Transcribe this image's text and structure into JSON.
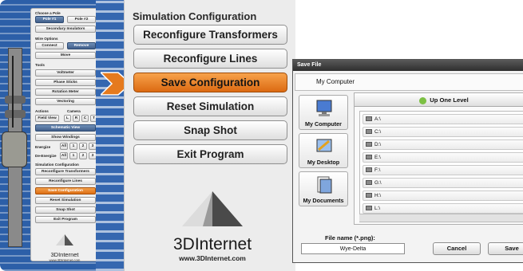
{
  "tool_panel": {
    "choose_pole_header": "Choose a Pole",
    "pole1": "Pole #1",
    "pole2": "Pole #2",
    "secondary_insulators": "Secondary Insulators",
    "wire_options_header": "Wire Options",
    "connect": "Connect",
    "remove": "Remove",
    "move": "Move",
    "tools_header": "Tools",
    "voltmeter": "Voltmeter",
    "phase_sticks": "Phase Sticks",
    "rotation_meter": "Rotation Meter",
    "vectoring": "Vectoring",
    "actions_header": "Actions",
    "camera_header": "Camera",
    "field_view": "Field View",
    "camera_views": [
      "L",
      "R",
      "C",
      "T"
    ],
    "schematic_view": "Schematic View",
    "show_windings": "Show Windings",
    "energize_header": "Energize",
    "de_energize_header": "De-Energize",
    "all": "All",
    "phases": [
      "1",
      "2",
      "3"
    ],
    "sim_config_header": "Simulation Configuration",
    "reconfigure_transformers": "Reconfigure Transformers",
    "reconfigure_lines": "Reconfigure Lines",
    "save_configuration": "Save Configuration",
    "reset_simulation": "Reset Simulation",
    "snap_shot": "Snap Shot",
    "exit_program": "Exit Program",
    "logo_brand": "3DInternet",
    "logo_url": "www.3DInternet.com"
  },
  "config_panel": {
    "title": "Simulation Configuration",
    "buttons": [
      "Reconfigure Transformers",
      "Reconfigure Lines",
      "Save Configuration",
      "Reset Simulation",
      "Snap Shot",
      "Exit Program"
    ],
    "logo_brand": "3DInternet",
    "logo_url": "www.3DInternet.com"
  },
  "save_dialog": {
    "title": "Save File",
    "current_path": "My Computer",
    "places": [
      "My Computer",
      "My Desktop",
      "My Documents"
    ],
    "up_one_level": "Up One Level",
    "drives": [
      "A:\\",
      "C:\\",
      "D:\\",
      "E:\\",
      "F:\\",
      "G:\\",
      "H:\\",
      "L:\\"
    ],
    "file_name_label": "File name (*.png):",
    "file_name_value": "Wye-Delta",
    "cancel": "Cancel",
    "save": "Save"
  },
  "colors": {
    "accent_orange": "#e57a1e",
    "blueprint_blue": "#2c5fa8",
    "selected_blue": "#4f6f9c"
  }
}
